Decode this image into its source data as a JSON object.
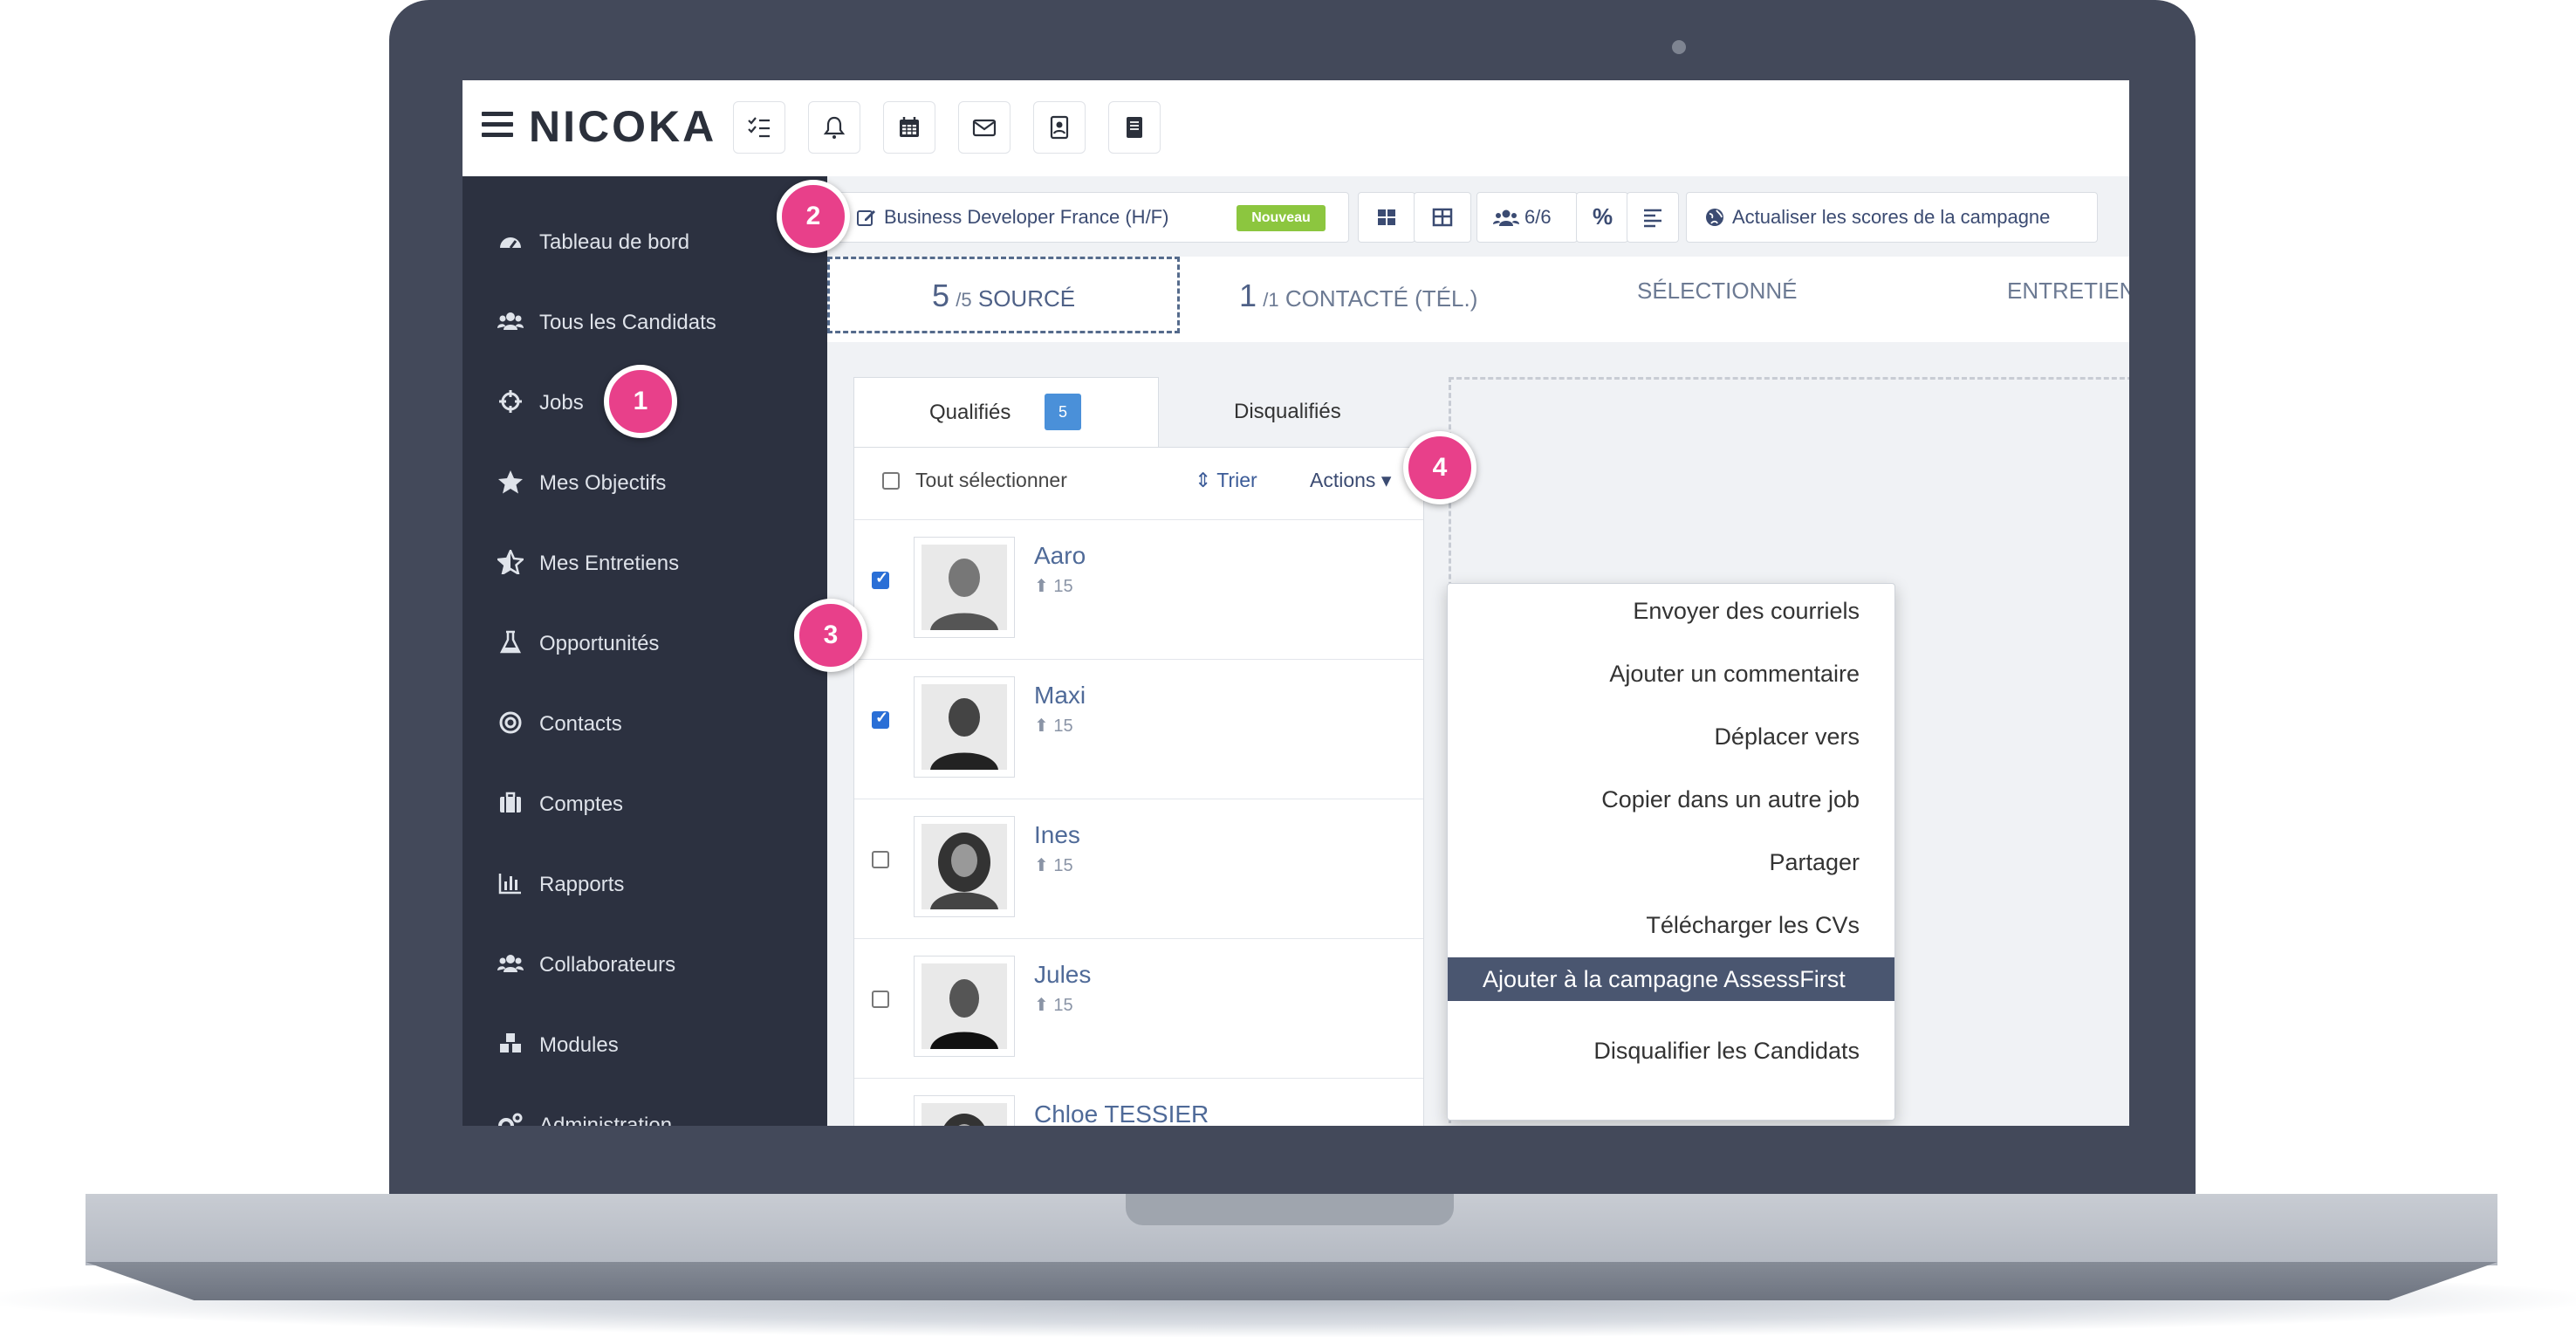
{
  "app": {
    "logo": "NICOKA",
    "toolbar_icons": [
      "checklist-icon",
      "bell-icon",
      "calendar-icon",
      "mail-icon",
      "contact-card-icon",
      "book-icon"
    ]
  },
  "sidebar": {
    "items": [
      {
        "label": "Tableau de bord",
        "icon": "dashboard-icon"
      },
      {
        "label": "Tous les Candidats",
        "icon": "users-icon"
      },
      {
        "label": "Jobs",
        "icon": "crosshair-icon"
      },
      {
        "label": "Mes Objectifs",
        "icon": "star-icon"
      },
      {
        "label": "Mes Entretiens",
        "icon": "star-half-icon"
      },
      {
        "label": "Opportunités",
        "icon": "flask-icon"
      },
      {
        "label": "Contacts",
        "icon": "target-icon"
      },
      {
        "label": "Comptes",
        "icon": "briefcase-icon"
      },
      {
        "label": "Rapports",
        "icon": "bar-chart-icon"
      },
      {
        "label": "Collaborateurs",
        "icon": "team-icon"
      },
      {
        "label": "Modules",
        "icon": "modules-icon"
      },
      {
        "label": "Administration",
        "icon": "gears-icon"
      }
    ]
  },
  "job_toolbar": {
    "job_title": "Business Developer France (H/F)",
    "badge": "Nouveau",
    "count_label": "6/6",
    "percent_label": "%",
    "refresh_label": "Actualiser les scores de la campagne"
  },
  "stages": [
    {
      "count": "5",
      "total": "/5",
      "label": "SOURCÉ"
    },
    {
      "count": "1",
      "total": "/1",
      "label": "CONTACTÉ (TÉL.)"
    },
    {
      "count": "",
      "total": "",
      "label": "SÉLECTIONNÉ"
    },
    {
      "count": "",
      "total": "",
      "label": "ENTRETIEN"
    }
  ],
  "tabs": {
    "qualified": "Qualifiés",
    "qualified_count": "5",
    "disqualified": "Disqualifiés"
  },
  "list_controls": {
    "select_all": "Tout sélectionner",
    "sort": "Trier",
    "actions": "Actions"
  },
  "candidates": [
    {
      "name": "Aaro",
      "meta": "15",
      "checked": true
    },
    {
      "name": "Maxi",
      "meta": "15",
      "checked": true
    },
    {
      "name": "Ines",
      "meta": "15",
      "checked": false
    },
    {
      "name": "Jules",
      "meta": "15",
      "checked": false
    },
    {
      "name": "Chloe TESSIER",
      "meta": "",
      "checked": false
    }
  ],
  "actions_menu": [
    "Envoyer des courriels",
    "Ajouter un commentaire",
    "Déplacer vers",
    "Copier dans un autre job",
    "Partager",
    "Télécharger les CVs",
    "Ajouter à la campagne AssessFirst",
    "Disqualifier les Candidats"
  ],
  "highlighted_action": "Ajouter à la campagne AssessFirst",
  "markers": [
    "1",
    "2",
    "3",
    "4"
  ],
  "colors": {
    "sidebar": "#2c3140",
    "accent_marker": "#e8408a",
    "badge_new": "#8cc63f",
    "highlight": "#4a5670",
    "link": "#4f6a98"
  }
}
